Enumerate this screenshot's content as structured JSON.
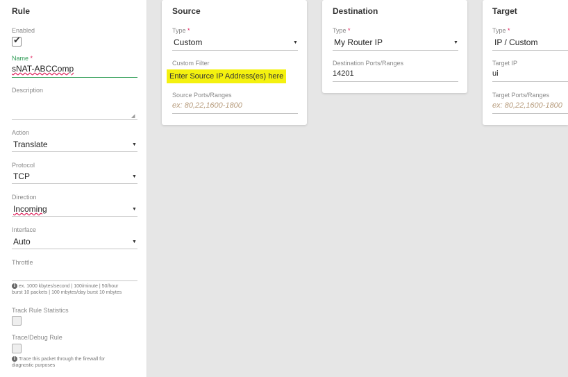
{
  "rule": {
    "title": "Rule",
    "enabled_label": "Enabled",
    "enabled_checked": true,
    "name_label": "Name",
    "name_value": "sNAT-ABCComp",
    "description_label": "Description",
    "action_label": "Action",
    "action_value": "Translate",
    "protocol_label": "Protocol",
    "protocol_value": "TCP",
    "direction_label": "Direction",
    "direction_value": "Incoming",
    "interface_label": "Interface",
    "interface_value": "Auto",
    "throttle_label": "Throttle",
    "throttle_hint_line1": "ex. 1000 kbytes/second | 100/minute | 50/hour",
    "throttle_hint_line2": "burst 10 packets | 100 mbytes/day burst 10 mbytes",
    "track_label": "Track Rule Statistics",
    "trace_label": "Trace/Debug Rule",
    "trace_hint_line1": "Trace this packet through the firewall for",
    "trace_hint_line2": "diagnostic purposes"
  },
  "source": {
    "title": "Source",
    "type_label": "Type",
    "type_value": "Custom",
    "custom_filter_label": "Custom Filter",
    "custom_filter_value": "Enter Source IP Address(es) here",
    "ports_label": "Source Ports/Ranges",
    "ports_placeholder": "ex: 80,22,1600-1800"
  },
  "destination": {
    "title": "Destination",
    "type_label": "Type",
    "type_value": "My Router IP",
    "ports_label": "Destination Ports/Ranges",
    "ports_value": "14201"
  },
  "target": {
    "title": "Target",
    "type_label": "Type",
    "type_value": "IP / Custom",
    "ip_label": "Target IP",
    "ip_value": "ui",
    "ports_label": "Target Ports/Ranges",
    "ports_placeholder": "ex: 80,22,1600-1800"
  },
  "required_marker": "*",
  "caret": "▼",
  "check": "✔",
  "info": "i",
  "colors": {
    "highlight": "#f4f10f",
    "required": "#e0245e",
    "focus_green": "#2e9b55"
  }
}
